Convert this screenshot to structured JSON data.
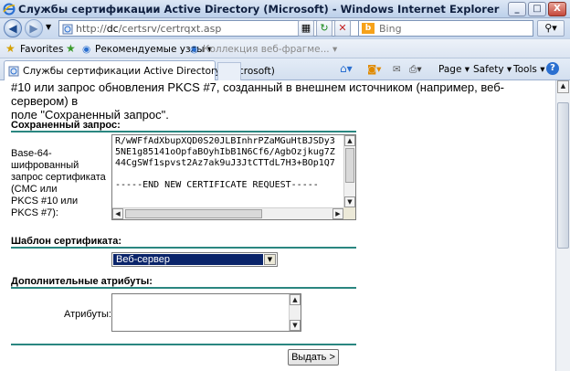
{
  "window": {
    "title": "Службы сертификации Active Directory (Microsoft) - Windows Internet Explorer",
    "controls": [
      "_",
      "□",
      "X"
    ]
  },
  "address": {
    "url_prefix": "http://",
    "url_host": "dc",
    "url_path": "/certsrv/certrqxt.asp",
    "search_placeholder": "Bing"
  },
  "favorites": {
    "label": "Favorites",
    "items": [
      "Рекомендуемые узлы ▾",
      "Коллекция веб-фрагме... ▾"
    ]
  },
  "tab": {
    "label": "Службы сертификации Active Directory (Microsoft)"
  },
  "commandbar": {
    "page": "Page ▾",
    "safety": "Safety ▾",
    "tools": "Tools ▾"
  },
  "page": {
    "intro_line1": "#10 или запрос обновления PKCS #7, созданный в внешнем источником (например, веб-сервером) в",
    "intro_line2": "поле \"Сохраненный запрос\".",
    "saved_request": {
      "heading": "Сохраненный запрос:",
      "label_lines": [
        "Base-64-шифрованный",
        "запрос сертификата",
        "(CMC или",
        "PKCS #10 или",
        "PKCS #7):"
      ],
      "textarea_lines": [
        "R/wWFfAdXbupXQD0S20JLBInhrPZaMGuHtBJSDy3",
        "5NE1g85141oOpfaBOyhIbB1N6Cf6/AgbOzjkug7Z",
        "44CgSWf1spvst2Az7ak9uJ3JtCTTdL7H3+BOp1Q7",
        "",
        "-----END NEW CERTIFICATE REQUEST-----"
      ]
    },
    "template": {
      "heading": "Шаблон сертификата:",
      "selected": "Веб-сервер"
    },
    "attributes": {
      "heading": "Дополнительные атрибуты:",
      "label": "Атрибуты:",
      "value": ""
    },
    "submit_label": "Выдать >"
  },
  "colors": {
    "rule": "#2a8680",
    "select_highlight": "#0a246a"
  }
}
